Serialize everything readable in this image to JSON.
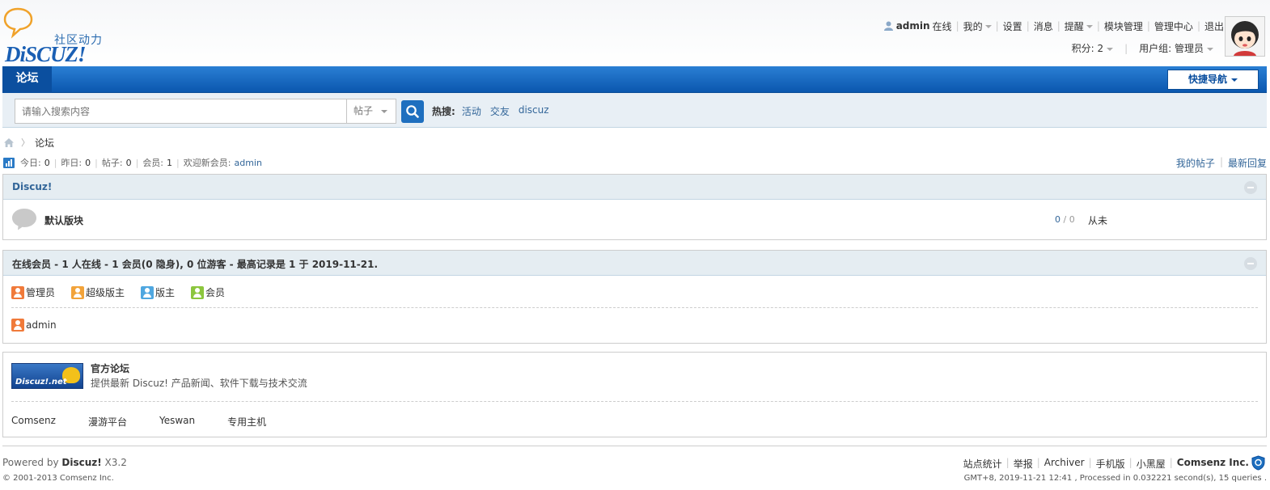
{
  "header": {
    "logo_subtitle": "社区动力",
    "logo_word": "DiSCUZ!",
    "username": "admin",
    "online": "在线",
    "my": "我的",
    "settings": "设置",
    "messages": "消息",
    "reminders": "提醒",
    "module_manage": "模块管理",
    "admin_center": "管理中心",
    "logout": "退出",
    "credits": "积分: 2",
    "usergroup": "用户组: 管理员"
  },
  "nav": {
    "forum": "论坛",
    "quick_nav": "快捷导航"
  },
  "search": {
    "placeholder": "请输入搜索内容",
    "type": "帖子",
    "hot_label": "热搜:",
    "hot_terms": [
      "活动",
      "交友",
      "discuz"
    ]
  },
  "breadcrumb": {
    "current": "论坛"
  },
  "stats": {
    "today_label": "今日:",
    "today": "0",
    "yesterday_label": "昨日:",
    "yesterday": "0",
    "posts_label": "帖子:",
    "posts": "0",
    "members_label": "会员:",
    "members": "1",
    "welcome_label": "欢迎新会员:",
    "newest_member": "admin",
    "my_posts": "我的帖子",
    "latest_replies": "最新回复"
  },
  "category": {
    "title": "Discuz!",
    "forum_name": "默认版块",
    "threads": "0",
    "posts": "0",
    "last_post": "从未"
  },
  "online": {
    "title": "在线会员 - 1 人在线 - 1 会员(0 隐身), 0 位游客 - 最高记录是 1 于 2019-11-21.",
    "legend": [
      {
        "label": "管理员",
        "color": "#f07a3a"
      },
      {
        "label": "超级版主",
        "color": "#f2a33a"
      },
      {
        "label": "版主",
        "color": "#4fa7e0"
      },
      {
        "label": "会员",
        "color": "#8cc63e"
      }
    ],
    "user": "admin",
    "user_color": "#f07a3a"
  },
  "links": {
    "logo_text": "Discuz!.net",
    "title": "官方论坛",
    "desc": "提供最新 Discuz! 产品新闻、软件下载与技术交流",
    "items": [
      "Comsenz",
      "漫游平台",
      "Yeswan",
      "专用主机"
    ]
  },
  "footer": {
    "powered_prefix": "Powered by ",
    "powered_brand": "Discuz!",
    "version": " X3.2",
    "copyright": "© 2001-2013 Comsenz Inc.",
    "links": [
      "站点统计",
      "举报",
      "Archiver",
      "手机版",
      "小黑屋"
    ],
    "company": "Comsenz Inc.",
    "debug": "GMT+8, 2019-11-21 12:41 , Processed in 0.032221 second(s), 15 queries ."
  }
}
